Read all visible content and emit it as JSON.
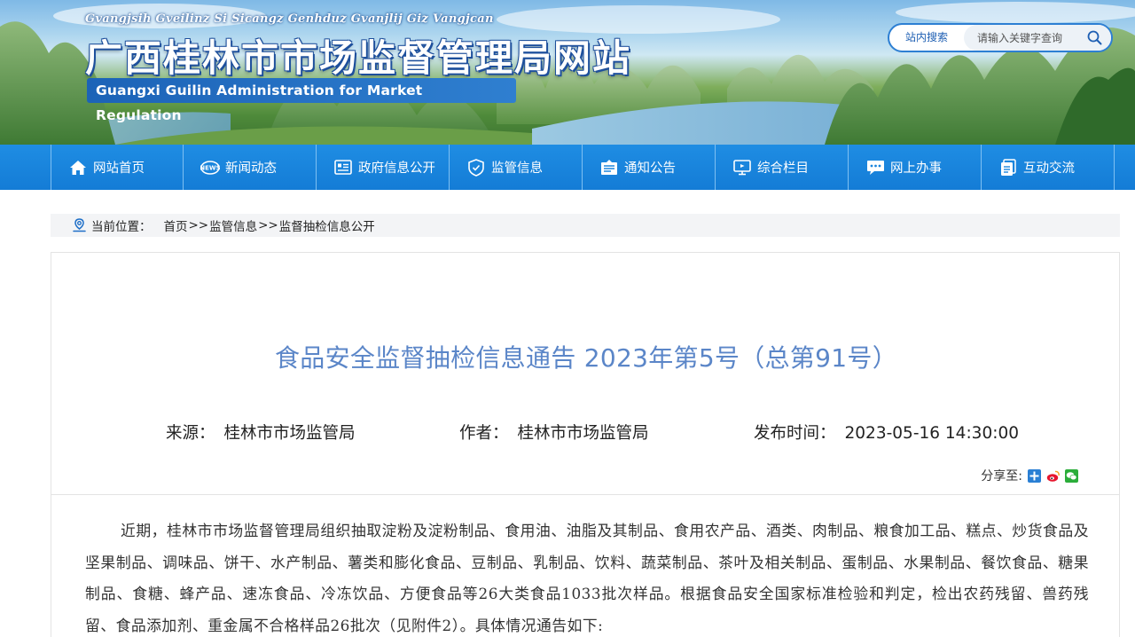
{
  "header": {
    "pinyin": "Gvangjsih Gveilinz Si Sicangz Genhduz Gvanjlij Giz Vangjcan",
    "title": "广西桂林市市场监督管理局网站",
    "title_en": "Guangxi Guilin Administration for Market Regulation",
    "search": {
      "scope_label": "站内搜索",
      "placeholder": "请输入关键字查询",
      "button_icon": "search-icon"
    }
  },
  "nav": {
    "items": [
      {
        "label": "网站首页",
        "icon": "home-icon"
      },
      {
        "label": "新闻动态",
        "icon": "news-icon"
      },
      {
        "label": "政府信息公开",
        "icon": "document-list-icon"
      },
      {
        "label": "监管信息",
        "icon": "shield-icon"
      },
      {
        "label": "通知公告",
        "icon": "notice-icon"
      },
      {
        "label": "综合栏目",
        "icon": "monitor-icon"
      },
      {
        "label": "网上办事",
        "icon": "chat-icon"
      },
      {
        "label": "互动交流",
        "icon": "copy-icon"
      }
    ]
  },
  "breadcrumb": {
    "label": "当前位置：",
    "items": [
      "首页",
      "监管信息",
      "监督抽检信息公开"
    ],
    "separator": ">>"
  },
  "article": {
    "title": "食品安全监督抽检信息通告 2023年第5号（总第91号）",
    "source_label": "来源：",
    "source": "桂林市市场监管局",
    "author_label": "作者：",
    "author": "桂林市市场监管局",
    "date_label": "发布时间：",
    "date": "2023-05-16 14:30:00",
    "share_label": "分享至:",
    "body": "近期，桂林市市场监督管理局组织抽取淀粉及淀粉制品、食用油、油脂及其制品、食用农产品、酒类、肉制品、粮食加工品、糕点、炒货食品及坚果制品、调味品、饼干、水产制品、薯类和膨化食品、豆制品、乳制品、饮料、蔬菜制品、茶叶及相关制品、蛋制品、水果制品、餐饮食品、糖果制品、食糖、蜂产品、速冻食品、冷冻饮品、方便食品等26大类食品1033批次样品。根据食品安全国家标准检验和判定，检出农药残留、兽药残留、食品添加剂、重金属不合格样品26批次（见附件2）。具体情况通告如下:"
  },
  "colors": {
    "nav_bg": "#1a85dd",
    "title_blue": "#5b86c8",
    "brand_blue": "#1d4f9c"
  }
}
